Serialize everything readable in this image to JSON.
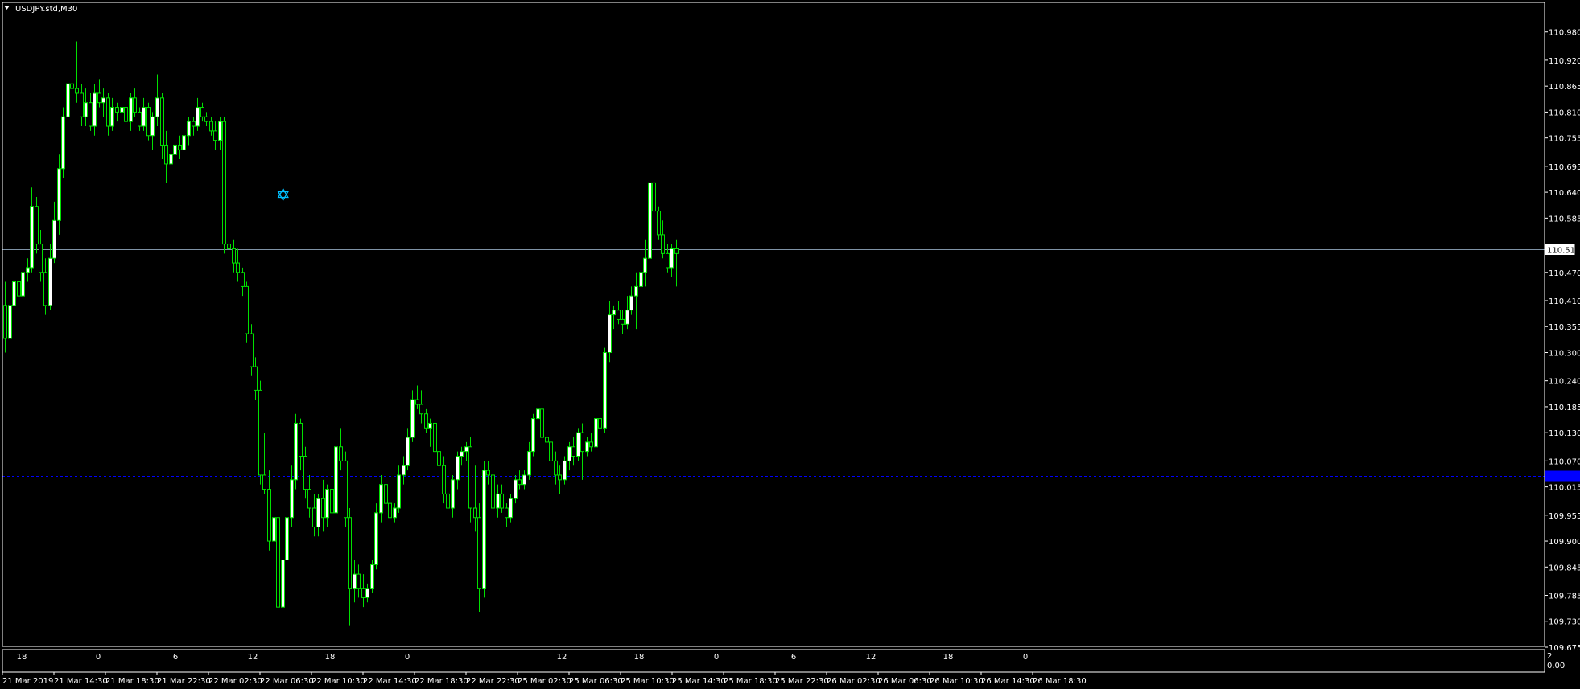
{
  "window": {
    "title": "USDJPY.std,M30",
    "menu_icon": "triangle-down-icon"
  },
  "colors": {
    "background": "#000000",
    "frame": "#ffffff",
    "bull_body": "#ffffff",
    "bear_body": "#000000",
    "wick": "#00e000",
    "bid_line": "#7f93a6",
    "ask_line": "#0000ff",
    "ask_label_bg": "#0000ff",
    "marker": "#00c0ff"
  },
  "price_axis": {
    "labels": [
      "110.980",
      "110.920",
      "110.865",
      "110.810",
      "110.755",
      "110.695",
      "110.640",
      "110.585",
      "110.470",
      "110.410",
      "110.355",
      "110.300",
      "110.240",
      "110.185",
      "110.130",
      "110.070",
      "110.015",
      "109.955",
      "109.900",
      "109.845",
      "109.785",
      "109.730",
      "109.675"
    ],
    "min": 109.675,
    "max": 111.0,
    "bid_label": "110.519",
    "bid_value": 110.519,
    "ask_value": 110.038
  },
  "subwindow": {
    "scale_top": "2",
    "scale_bottom": "0.00"
  },
  "hour_axis": {
    "labels": [
      "18",
      "0",
      "6",
      "12",
      "18",
      "0",
      "12",
      "18",
      "0",
      "6",
      "12",
      "18",
      "0"
    ]
  },
  "time_axis": {
    "labels": [
      "21 Mar 2019",
      "21 Mar 14:30",
      "21 Mar 18:30",
      "21 Mar 22:30",
      "22 Mar 02:30",
      "22 Mar 06:30",
      "22 Mar 10:30",
      "22 Mar 14:30",
      "22 Mar 18:30",
      "22 Mar 22:30",
      "25 Mar 02:30",
      "25 Mar 06:30",
      "25 Mar 10:30",
      "25 Mar 14:30",
      "25 Mar 18:30",
      "25 Mar 22:30",
      "26 Mar 02:30",
      "26 Mar 06:30",
      "26 Mar 10:30",
      "26 Mar 14:30",
      "26 Mar 18:30"
    ]
  },
  "marker": {
    "icon": "star-of-david-icon",
    "price": 110.635,
    "bar": 62
  },
  "chart_data": {
    "type": "candlestick",
    "symbol": "USDJPY.std,M30",
    "ylim": [
      109.675,
      111.0
    ],
    "candles": [
      [
        110.4,
        110.45,
        110.3,
        110.33
      ],
      [
        110.33,
        110.43,
        110.3,
        110.4
      ],
      [
        110.4,
        110.47,
        110.38,
        110.45
      ],
      [
        110.45,
        110.48,
        110.4,
        110.42
      ],
      [
        110.42,
        110.49,
        110.39,
        110.47
      ],
      [
        110.47,
        110.5,
        110.45,
        110.48
      ],
      [
        110.48,
        110.65,
        110.47,
        110.61
      ],
      [
        110.61,
        110.63,
        110.51,
        110.53
      ],
      [
        110.53,
        110.56,
        110.45,
        110.47
      ],
      [
        110.47,
        110.5,
        110.38,
        110.4
      ],
      [
        110.4,
        110.53,
        110.39,
        110.5
      ],
      [
        110.5,
        110.62,
        110.49,
        110.58
      ],
      [
        110.58,
        110.72,
        110.55,
        110.69
      ],
      [
        110.69,
        110.82,
        110.67,
        110.8
      ],
      [
        110.8,
        110.89,
        110.78,
        110.87
      ],
      [
        110.87,
        110.91,
        110.84,
        110.86
      ],
      [
        110.86,
        110.96,
        110.83,
        110.85
      ],
      [
        110.85,
        110.87,
        110.78,
        110.8
      ],
      [
        110.8,
        110.86,
        110.78,
        110.83
      ],
      [
        110.83,
        110.85,
        110.77,
        110.78
      ],
      [
        110.78,
        110.87,
        110.76,
        110.85
      ],
      [
        110.85,
        110.88,
        110.82,
        110.83
      ],
      [
        110.83,
        110.86,
        110.8,
        110.84
      ],
      [
        110.84,
        110.85,
        110.76,
        110.78
      ],
      [
        110.78,
        110.84,
        110.77,
        110.82
      ],
      [
        110.82,
        110.83,
        110.79,
        110.81
      ],
      [
        110.81,
        110.84,
        110.8,
        110.82
      ],
      [
        110.82,
        110.83,
        110.78,
        110.79
      ],
      [
        110.79,
        110.85,
        110.77,
        110.84
      ],
      [
        110.84,
        110.86,
        110.8,
        110.81
      ],
      [
        110.81,
        110.82,
        110.77,
        110.78
      ],
      [
        110.78,
        110.84,
        110.77,
        110.82
      ],
      [
        110.82,
        110.83,
        110.75,
        110.76
      ],
      [
        110.76,
        110.81,
        110.73,
        110.8
      ],
      [
        110.8,
        110.89,
        110.78,
        110.84
      ],
      [
        110.84,
        110.85,
        110.71,
        110.74
      ],
      [
        110.74,
        110.77,
        110.66,
        110.7
      ],
      [
        110.7,
        110.76,
        110.64,
        110.72
      ],
      [
        110.72,
        110.76,
        110.69,
        110.74
      ],
      [
        110.74,
        110.76,
        110.71,
        110.73
      ],
      [
        110.73,
        110.78,
        110.72,
        110.76
      ],
      [
        110.76,
        110.8,
        110.74,
        110.79
      ],
      [
        110.79,
        110.8,
        110.76,
        110.78
      ],
      [
        110.78,
        110.84,
        110.77,
        110.82
      ],
      [
        110.82,
        110.83,
        110.79,
        110.8
      ],
      [
        110.8,
        110.81,
        110.78,
        110.79
      ],
      [
        110.79,
        110.8,
        110.76,
        110.77
      ],
      [
        110.77,
        110.79,
        110.73,
        110.75
      ],
      [
        110.75,
        110.8,
        110.73,
        110.79
      ],
      [
        110.79,
        110.8,
        110.51,
        110.53
      ],
      [
        110.53,
        110.58,
        110.5,
        110.52
      ],
      [
        110.52,
        110.54,
        110.47,
        110.49
      ],
      [
        110.49,
        110.52,
        110.45,
        110.47
      ],
      [
        110.47,
        110.48,
        110.42,
        110.44
      ],
      [
        110.44,
        110.45,
        110.32,
        110.34
      ],
      [
        110.34,
        110.36,
        110.25,
        110.27
      ],
      [
        110.27,
        110.29,
        110.2,
        110.22
      ],
      [
        110.22,
        110.24,
        110.02,
        110.04
      ],
      [
        110.04,
        110.13,
        110.0,
        110.01
      ],
      [
        110.01,
        110.05,
        109.88,
        109.9
      ],
      [
        109.9,
        110.01,
        109.87,
        109.95
      ],
      [
        109.95,
        109.97,
        109.74,
        109.76
      ],
      [
        109.76,
        109.88,
        109.75,
        109.86
      ],
      [
        109.86,
        109.97,
        109.84,
        109.95
      ],
      [
        109.95,
        110.06,
        109.93,
        110.03
      ],
      [
        110.03,
        110.17,
        110.01,
        110.15
      ],
      [
        110.15,
        110.16,
        110.05,
        110.08
      ],
      [
        110.08,
        110.1,
        109.99,
        110.01
      ],
      [
        110.01,
        110.04,
        109.95,
        109.97
      ],
      [
        109.97,
        110.0,
        109.91,
        109.93
      ],
      [
        109.93,
        110.0,
        109.91,
        109.99
      ],
      [
        109.99,
        110.03,
        109.92,
        109.95
      ],
      [
        109.95,
        110.02,
        109.93,
        110.01
      ],
      [
        110.01,
        110.08,
        109.94,
        109.96
      ],
      [
        109.96,
        110.12,
        109.95,
        110.1
      ],
      [
        110.1,
        110.14,
        110.05,
        110.07
      ],
      [
        110.07,
        110.09,
        109.93,
        109.95
      ],
      [
        109.95,
        109.97,
        109.72,
        109.8
      ],
      [
        109.8,
        109.86,
        109.77,
        109.83
      ],
      [
        109.83,
        109.85,
        109.78,
        109.8
      ],
      [
        109.8,
        109.83,
        109.76,
        109.78
      ],
      [
        109.78,
        109.81,
        109.77,
        109.8
      ],
      [
        109.8,
        109.86,
        109.79,
        109.85
      ],
      [
        109.85,
        109.98,
        109.84,
        109.96
      ],
      [
        109.96,
        110.04,
        109.94,
        110.02
      ],
      [
        110.02,
        110.03,
        109.96,
        109.98
      ],
      [
        109.98,
        110.01,
        109.92,
        109.95
      ],
      [
        109.95,
        109.98,
        109.94,
        109.97
      ],
      [
        109.97,
        110.06,
        109.96,
        110.04
      ],
      [
        110.04,
        110.08,
        110.02,
        110.06
      ],
      [
        110.06,
        110.14,
        110.05,
        110.12
      ],
      [
        110.12,
        110.22,
        110.11,
        110.2
      ],
      [
        110.2,
        110.23,
        110.18,
        110.19
      ],
      [
        110.19,
        110.22,
        110.15,
        110.17
      ],
      [
        110.17,
        110.18,
        110.13,
        110.14
      ],
      [
        110.14,
        110.16,
        110.1,
        110.15
      ],
      [
        110.15,
        110.16,
        110.08,
        110.09
      ],
      [
        110.09,
        110.1,
        110.04,
        110.06
      ],
      [
        110.06,
        110.08,
        109.98,
        110.0
      ],
      [
        110.0,
        110.05,
        109.95,
        109.97
      ],
      [
        109.97,
        110.04,
        109.95,
        110.03
      ],
      [
        110.03,
        110.09,
        110.01,
        110.08
      ],
      [
        110.08,
        110.1,
        110.06,
        110.09
      ],
      [
        110.09,
        110.11,
        110.07,
        110.1
      ],
      [
        110.1,
        110.12,
        109.94,
        109.97
      ],
      [
        109.97,
        110.06,
        109.92,
        109.95
      ],
      [
        109.95,
        109.98,
        109.75,
        109.8
      ],
      [
        109.8,
        110.07,
        109.78,
        110.05
      ],
      [
        110.05,
        110.07,
        110.02,
        110.04
      ],
      [
        110.04,
        110.06,
        109.95,
        109.97
      ],
      [
        109.97,
        110.02,
        109.95,
        110.0
      ],
      [
        110.0,
        110.02,
        109.96,
        109.97
      ],
      [
        109.97,
        109.98,
        109.93,
        109.95
      ],
      [
        109.95,
        110.0,
        109.94,
        109.99
      ],
      [
        109.99,
        110.04,
        109.98,
        110.03
      ],
      [
        110.03,
        110.05,
        110.01,
        110.02
      ],
      [
        110.02,
        110.05,
        110.01,
        110.04
      ],
      [
        110.04,
        110.11,
        110.03,
        110.09
      ],
      [
        110.09,
        110.17,
        110.08,
        110.16
      ],
      [
        110.16,
        110.23,
        110.14,
        110.18
      ],
      [
        110.18,
        110.19,
        110.1,
        110.12
      ],
      [
        110.12,
        110.14,
        110.08,
        110.11
      ],
      [
        110.11,
        110.12,
        110.05,
        110.07
      ],
      [
        110.07,
        110.09,
        110.02,
        110.04
      ],
      [
        110.04,
        110.06,
        110.0,
        110.03
      ],
      [
        110.03,
        110.08,
        110.02,
        110.07
      ],
      [
        110.07,
        110.11,
        110.05,
        110.1
      ],
      [
        110.1,
        110.12,
        110.06,
        110.08
      ],
      [
        110.08,
        110.14,
        110.07,
        110.13
      ],
      [
        110.13,
        110.15,
        110.03,
        110.09
      ],
      [
        110.09,
        110.12,
        110.08,
        110.11
      ],
      [
        110.11,
        110.13,
        110.09,
        110.1
      ],
      [
        110.1,
        110.18,
        110.09,
        110.16
      ],
      [
        110.16,
        110.19,
        110.12,
        110.14
      ],
      [
        110.14,
        110.31,
        110.13,
        110.3
      ],
      [
        110.3,
        110.41,
        110.28,
        110.38
      ],
      [
        110.38,
        110.4,
        110.35,
        110.39
      ],
      [
        110.39,
        110.41,
        110.36,
        110.37
      ],
      [
        110.37,
        110.39,
        110.34,
        110.36
      ],
      [
        110.36,
        110.42,
        110.35,
        110.39
      ],
      [
        110.39,
        110.44,
        110.38,
        110.42
      ],
      [
        110.42,
        110.47,
        110.35,
        110.44
      ],
      [
        110.44,
        110.52,
        110.43,
        110.47
      ],
      [
        110.47,
        110.54,
        110.44,
        110.5
      ],
      [
        110.5,
        110.68,
        110.49,
        110.66
      ],
      [
        110.66,
        110.68,
        110.58,
        110.6
      ],
      [
        110.6,
        110.61,
        110.54,
        110.55
      ],
      [
        110.55,
        110.58,
        110.5,
        110.51
      ],
      [
        110.51,
        110.53,
        110.47,
        110.48
      ],
      [
        110.48,
        110.53,
        110.46,
        110.52
      ],
      [
        110.52,
        110.54,
        110.44,
        110.51
      ]
    ]
  }
}
